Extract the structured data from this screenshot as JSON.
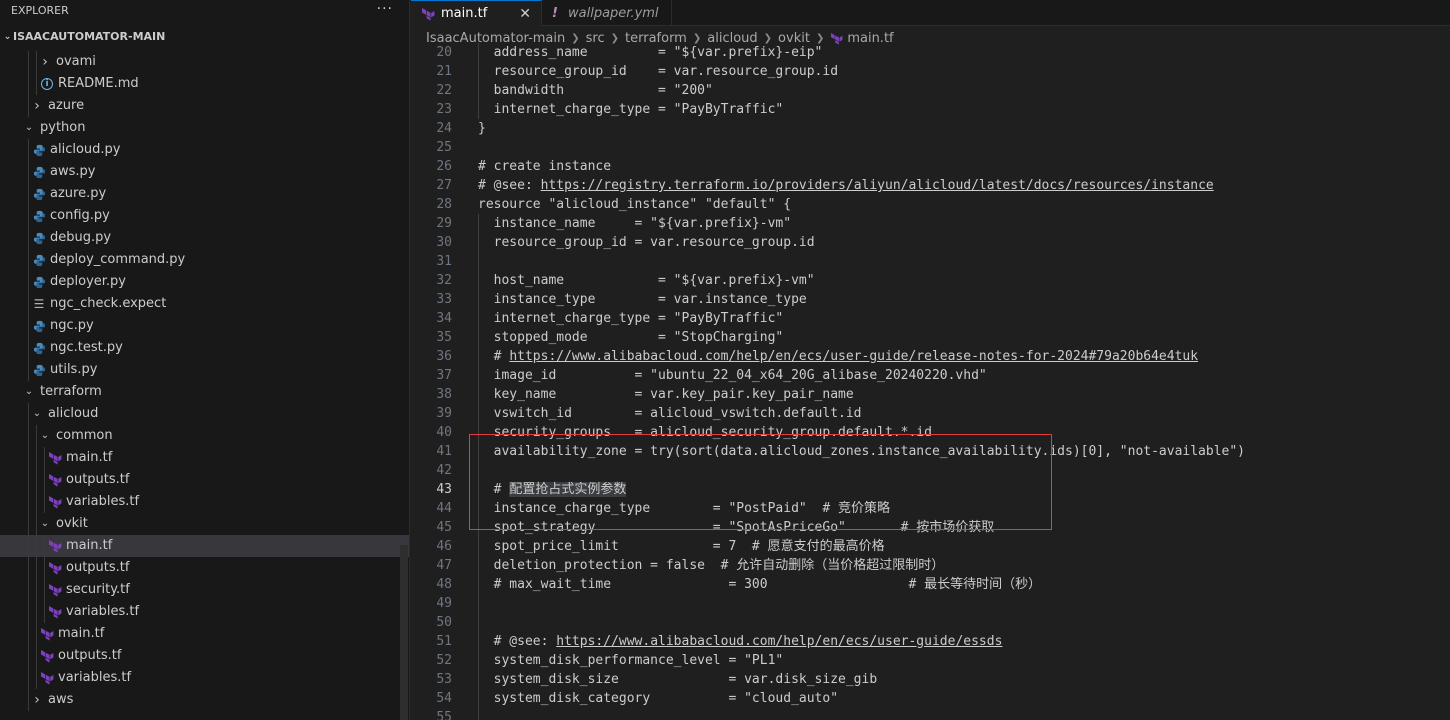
{
  "sidebar": {
    "header": "EXPLORER",
    "more_label": "···",
    "root": "ISAACAUTOMATOR-MAIN",
    "items": [
      {
        "label": "ovami",
        "kind": "folder-collapsed",
        "depth": 3
      },
      {
        "label": "README.md",
        "kind": "info",
        "depth": 3
      },
      {
        "label": "azure",
        "kind": "folder-collapsed",
        "depth": 2
      },
      {
        "label": "python",
        "kind": "folder-open",
        "depth": 1
      },
      {
        "label": "alicloud.py",
        "kind": "python",
        "depth": 2
      },
      {
        "label": "aws.py",
        "kind": "python",
        "depth": 2
      },
      {
        "label": "azure.py",
        "kind": "python",
        "depth": 2
      },
      {
        "label": "config.py",
        "kind": "python",
        "depth": 2
      },
      {
        "label": "debug.py",
        "kind": "python",
        "depth": 2
      },
      {
        "label": "deploy_command.py",
        "kind": "python",
        "depth": 2
      },
      {
        "label": "deployer.py",
        "kind": "python",
        "depth": 2
      },
      {
        "label": "ngc_check.expect",
        "kind": "text",
        "depth": 2
      },
      {
        "label": "ngc.py",
        "kind": "python",
        "depth": 2
      },
      {
        "label": "ngc.test.py",
        "kind": "python",
        "depth": 2
      },
      {
        "label": "utils.py",
        "kind": "python",
        "depth": 2
      },
      {
        "label": "terraform",
        "kind": "folder-open",
        "depth": 1
      },
      {
        "label": "alicloud",
        "kind": "folder-open",
        "depth": 2
      },
      {
        "label": "common",
        "kind": "folder-open",
        "depth": 3
      },
      {
        "label": "main.tf",
        "kind": "terraform",
        "depth": 4
      },
      {
        "label": "outputs.tf",
        "kind": "terraform",
        "depth": 4
      },
      {
        "label": "variables.tf",
        "kind": "terraform",
        "depth": 4
      },
      {
        "label": "ovkit",
        "kind": "folder-open",
        "depth": 3
      },
      {
        "label": "main.tf",
        "kind": "terraform",
        "depth": 4,
        "selected": true
      },
      {
        "label": "outputs.tf",
        "kind": "terraform",
        "depth": 4
      },
      {
        "label": "security.tf",
        "kind": "terraform",
        "depth": 4
      },
      {
        "label": "variables.tf",
        "kind": "terraform",
        "depth": 4
      },
      {
        "label": "main.tf",
        "kind": "terraform",
        "depth": 3
      },
      {
        "label": "outputs.tf",
        "kind": "terraform",
        "depth": 3
      },
      {
        "label": "variables.tf",
        "kind": "terraform",
        "depth": 3
      },
      {
        "label": "aws",
        "kind": "folder-collapsed",
        "depth": 2
      }
    ]
  },
  "tabs": [
    {
      "label": "main.tf",
      "active": true,
      "icon": "terraform-icon",
      "close": "✕"
    },
    {
      "label": "wallpaper.yml",
      "active": false,
      "icon": "exclamation-icon"
    }
  ],
  "breadcrumb": [
    "IsaacAutomator-main",
    "src",
    "terraform",
    "alicloud",
    "ovkit",
    "main.tf"
  ],
  "code": {
    "current_line": 43,
    "lines": [
      {
        "n": 20,
        "indent": 1,
        "segs": [
          {
            "t": "  address_name         = \"${var.prefix}-eip\""
          }
        ]
      },
      {
        "n": 21,
        "indent": 1,
        "segs": [
          {
            "t": "  resource_group_id    = var.resource_group.id"
          }
        ]
      },
      {
        "n": 22,
        "indent": 1,
        "segs": [
          {
            "t": "  bandwidth            = \"200\""
          }
        ]
      },
      {
        "n": 23,
        "indent": 1,
        "segs": [
          {
            "t": "  internet_charge_type = \"PayByTraffic\""
          }
        ]
      },
      {
        "n": 24,
        "indent": 0,
        "segs": [
          {
            "t": "}"
          }
        ]
      },
      {
        "n": 25,
        "indent": 0,
        "segs": [
          {
            "t": ""
          }
        ]
      },
      {
        "n": 26,
        "indent": 0,
        "segs": [
          {
            "t": "# create instance"
          }
        ]
      },
      {
        "n": 27,
        "indent": 0,
        "segs": [
          {
            "t": "# @see: "
          },
          {
            "t": "https://registry.terraform.io/providers/aliyun/alicloud/latest/docs/resources/instance",
            "url": true
          }
        ]
      },
      {
        "n": 28,
        "indent": 0,
        "segs": [
          {
            "t": "resource \"alicloud_instance\" \"default\" {"
          }
        ]
      },
      {
        "n": 29,
        "indent": 1,
        "segs": [
          {
            "t": "  instance_name     = \"${var.prefix}-vm\""
          }
        ]
      },
      {
        "n": 30,
        "indent": 1,
        "segs": [
          {
            "t": "  resource_group_id = var.resource_group.id"
          }
        ]
      },
      {
        "n": 31,
        "indent": 1,
        "segs": [
          {
            "t": ""
          }
        ]
      },
      {
        "n": 32,
        "indent": 1,
        "segs": [
          {
            "t": "  host_name            = \"${var.prefix}-vm\""
          }
        ]
      },
      {
        "n": 33,
        "indent": 1,
        "segs": [
          {
            "t": "  instance_type        = var.instance_type"
          }
        ]
      },
      {
        "n": 34,
        "indent": 1,
        "segs": [
          {
            "t": "  internet_charge_type = \"PayByTraffic\""
          }
        ]
      },
      {
        "n": 35,
        "indent": 1,
        "segs": [
          {
            "t": "  stopped_mode         = \"StopCharging\""
          }
        ]
      },
      {
        "n": 36,
        "indent": 1,
        "segs": [
          {
            "t": "  # "
          },
          {
            "t": "https://www.alibabacloud.com/help/en/ecs/user-guide/release-notes-for-2024#79a20b64e4tuk",
            "url": true
          }
        ]
      },
      {
        "n": 37,
        "indent": 1,
        "segs": [
          {
            "t": "  image_id          = \"ubuntu_22_04_x64_20G_alibase_20240220.vhd\""
          }
        ]
      },
      {
        "n": 38,
        "indent": 1,
        "segs": [
          {
            "t": "  key_name          = var.key_pair.key_pair_name"
          }
        ]
      },
      {
        "n": 39,
        "indent": 1,
        "segs": [
          {
            "t": "  vswitch_id        = alicloud_vswitch.default.id"
          }
        ]
      },
      {
        "n": 40,
        "indent": 1,
        "segs": [
          {
            "t": "  security_groups   = alicloud_security_group.default.*.id"
          }
        ]
      },
      {
        "n": 41,
        "indent": 1,
        "segs": [
          {
            "t": "  availability_zone = try(sort(data.alicloud_zones.instance_availability.ids)[0], \"not-available\")"
          }
        ]
      },
      {
        "n": 42,
        "indent": 1,
        "segs": [
          {
            "t": ""
          }
        ]
      },
      {
        "n": 43,
        "indent": 1,
        "segs": [
          {
            "t": "  # "
          },
          {
            "t": "配置抢占式实例参数",
            "sel": true
          }
        ]
      },
      {
        "n": 44,
        "indent": 1,
        "segs": [
          {
            "t": "  instance_charge_type        = \"PostPaid\"  # 竞价策略"
          }
        ]
      },
      {
        "n": 45,
        "indent": 1,
        "segs": [
          {
            "t": "  spot_strategy               = \"SpotAsPriceGo\"       # 按市场价获取"
          }
        ]
      },
      {
        "n": 46,
        "indent": 1,
        "segs": [
          {
            "t": "  spot_price_limit            = 7  # 愿意支付的最高价格"
          }
        ]
      },
      {
        "n": 47,
        "indent": 1,
        "segs": [
          {
            "t": "  deletion_protection = false  # 允许自动删除（当价格超过限制时）"
          }
        ]
      },
      {
        "n": 48,
        "indent": 1,
        "segs": [
          {
            "t": "  # max_wait_time               = 300                  # 最长等待时间（秒）"
          }
        ]
      },
      {
        "n": 49,
        "indent": 1,
        "segs": [
          {
            "t": ""
          }
        ]
      },
      {
        "n": 50,
        "indent": 1,
        "segs": [
          {
            "t": ""
          }
        ]
      },
      {
        "n": 51,
        "indent": 1,
        "segs": [
          {
            "t": "  # @see: "
          },
          {
            "t": "https://www.alibabacloud.com/help/en/ecs/user-guide/essds",
            "url": true
          }
        ]
      },
      {
        "n": 52,
        "indent": 1,
        "segs": [
          {
            "t": "  system_disk_performance_level = \"PL1\""
          }
        ]
      },
      {
        "n": 53,
        "indent": 1,
        "segs": [
          {
            "t": "  system_disk_size              = var.disk_size_gib"
          }
        ]
      },
      {
        "n": 54,
        "indent": 1,
        "segs": [
          {
            "t": "  system_disk_category          = \"cloud_auto\""
          }
        ]
      },
      {
        "n": 55,
        "indent": 1,
        "segs": [
          {
            "t": ""
          }
        ]
      }
    ]
  },
  "colors": {
    "terraform": "#7b42bc",
    "python": "#4b8bbe",
    "highlight_border": "#e33e3e",
    "accent": "#0078d4"
  }
}
